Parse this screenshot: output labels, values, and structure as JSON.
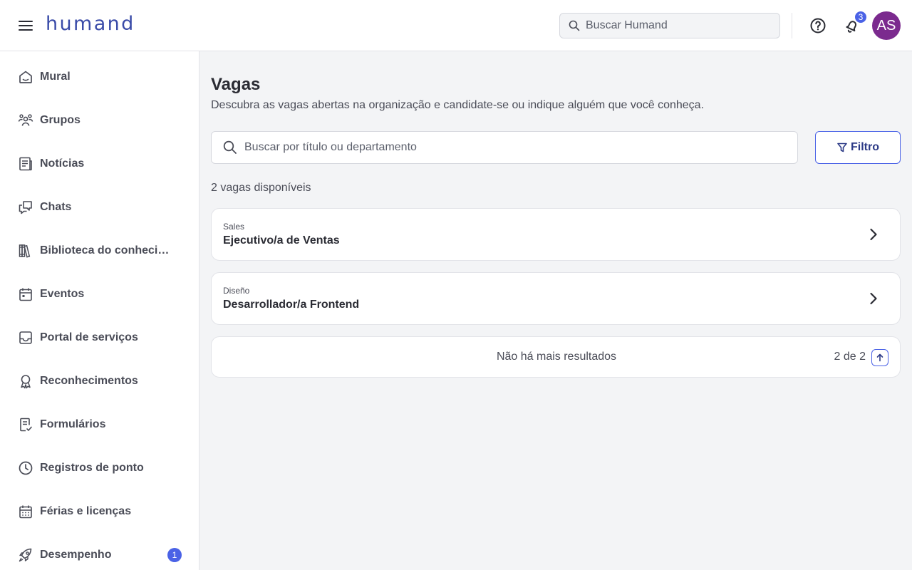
{
  "header": {
    "logo": "humand",
    "search_placeholder": "Buscar Humand",
    "notifications_count": "3",
    "avatar_initials": "AS",
    "avatar_color": "#7b2a8e"
  },
  "sidebar": {
    "items": [
      {
        "label": "Mural",
        "icon": "home-icon"
      },
      {
        "label": "Grupos",
        "icon": "groups-icon"
      },
      {
        "label": "Notícias",
        "icon": "news-icon"
      },
      {
        "label": "Chats",
        "icon": "chat-icon"
      },
      {
        "label": "Biblioteca do conhecimento",
        "icon": "library-icon"
      },
      {
        "label": "Eventos",
        "icon": "calendar-icon"
      },
      {
        "label": "Portal de serviços",
        "icon": "inbox-icon"
      },
      {
        "label": "Reconhecimentos",
        "icon": "award-icon"
      },
      {
        "label": "Formulários",
        "icon": "form-icon"
      },
      {
        "label": "Registros de ponto",
        "icon": "clock-icon"
      },
      {
        "label": "Férias e licenças",
        "icon": "calendar-grid-icon"
      },
      {
        "label": "Desempenho",
        "icon": "rocket-icon",
        "badge": "1"
      }
    ]
  },
  "main": {
    "title": "Vagas",
    "subtitle": "Descubra as vagas abertas na organização e candidate-se ou indique alguém que você conheça.",
    "search_placeholder": "Buscar por título ou departamento",
    "filter_label": "Filtro",
    "count_text": "2 vagas disponíveis",
    "jobs": [
      {
        "department": "Sales",
        "title": "Ejecutivo/a de Ventas"
      },
      {
        "department": "Diseño",
        "title": "Desarrollador/a Frontend"
      }
    ],
    "end_text": "Não há mais resultados",
    "pages_text": "2 de 2"
  },
  "colors": {
    "accent": "#4a62e6",
    "brand": "#3a4ba8"
  }
}
